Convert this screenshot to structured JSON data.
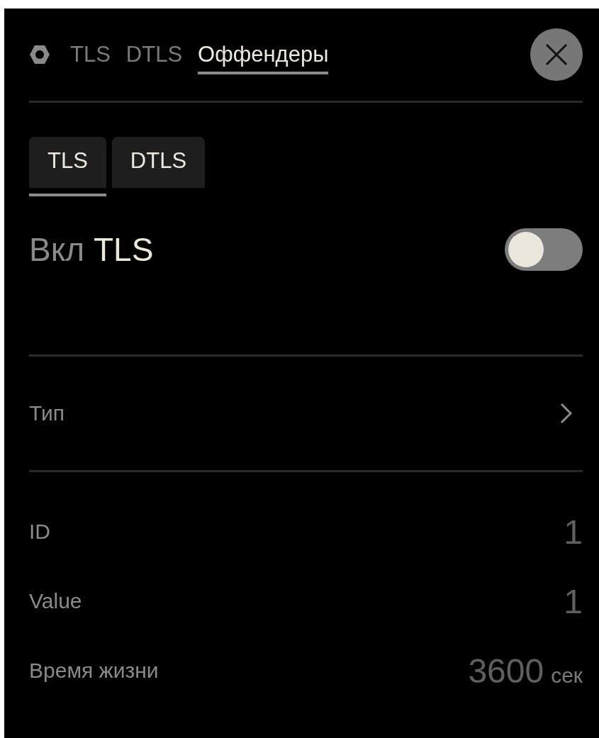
{
  "header": {
    "tabs": [
      {
        "label": "TLS",
        "selected": false
      },
      {
        "label": "DTLS",
        "selected": false
      },
      {
        "label": "Оффендеры",
        "selected": true
      }
    ]
  },
  "segments": [
    {
      "label": "TLS",
      "selected": true
    },
    {
      "label": "DTLS",
      "selected": false
    }
  ],
  "enable": {
    "prefix": "Вкл",
    "name": "TLS",
    "on": false
  },
  "type_row": {
    "label": "Тип"
  },
  "fields": [
    {
      "label": "ID",
      "value": "1"
    },
    {
      "label": "Value",
      "value": "1"
    },
    {
      "label": "Время жизни",
      "value": "3600",
      "unit": "сек"
    }
  ]
}
